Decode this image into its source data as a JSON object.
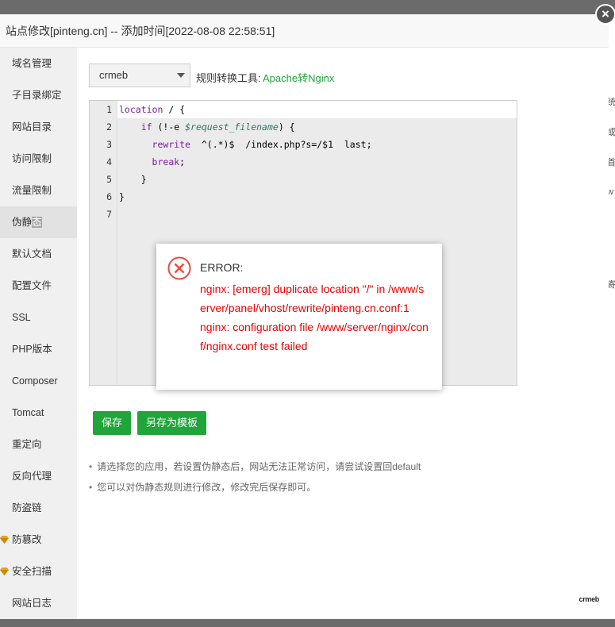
{
  "window": {
    "title": "站点修改[pinteng.cn] -- 添加时间[2022-08-08 22:58:51]",
    "close_label": "×"
  },
  "sidebar": {
    "items": [
      {
        "label": "域名管理"
      },
      {
        "label": "子目录绑定"
      },
      {
        "label": "网站目录"
      },
      {
        "label": "访问限制"
      },
      {
        "label": "流量限制"
      },
      {
        "label": "伪静",
        "label_tail": "态",
        "active": true
      },
      {
        "label": "默认文档"
      },
      {
        "label": "配置文件"
      },
      {
        "label": "SSL"
      },
      {
        "label": "PHP版本"
      },
      {
        "label": "Composer"
      },
      {
        "label": "Tomcat"
      },
      {
        "label": "重定向"
      },
      {
        "label": "反向代理"
      },
      {
        "label": "防盗链"
      },
      {
        "label": "防篡改",
        "icon": "gem-icon"
      },
      {
        "label": "安全扫描",
        "icon": "gem-icon"
      },
      {
        "label": "网站日志"
      }
    ]
  },
  "toolbar": {
    "select_value": "crmeb",
    "tool_label": "规则转换工具:",
    "tool_link": "Apache转Nginx"
  },
  "editor": {
    "line_numbers": [
      "1",
      "2",
      "3",
      "4",
      "5",
      "6",
      "7"
    ],
    "lines": [
      "location / {",
      "    if (!-e $request_filename) {",
      "      rewrite  ^(.*)$  /index.php?s=/$1  last;",
      "      break;",
      "    }",
      "}",
      ""
    ]
  },
  "buttons": {
    "save": "保存",
    "save_as_template": "另存为模板"
  },
  "notes": [
    "请选择您的应用，若设置伪静态后，网站无法正常访问，请尝试设置回default",
    "您可以对伪静态规则进行修改，修改完后保存即可。"
  ],
  "logo_text": "crmeb",
  "alert": {
    "title": "ERROR:",
    "message_1": "nginx: [emerg] duplicate location \"/\" in /www/server/panel/vhost/rewrite/pinteng.cn.conf:1",
    "message_2": "nginx: configuration file /www/server/nginx/conf/nginx.conf test failed",
    "icon": "error-circle-x-icon",
    "color": "#e60000"
  },
  "background_glyphs": [
    "统",
    "或",
    "首",
    "w",
    "寄"
  ],
  "colors": {
    "accent": "#20a53a",
    "error": "#e60000",
    "overlay": "#6b6b6b"
  }
}
